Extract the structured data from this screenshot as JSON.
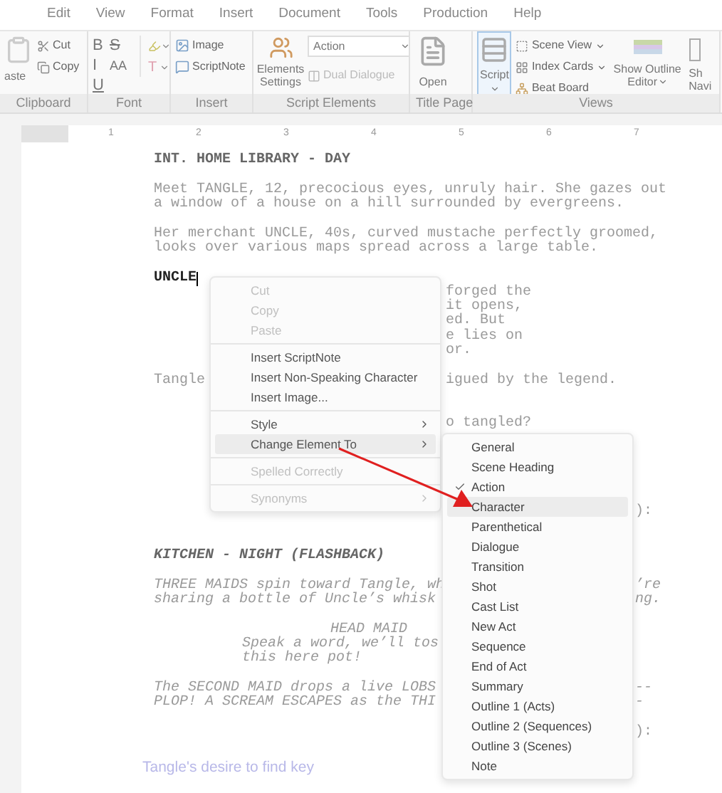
{
  "menu_bar": {
    "tabs": [
      {
        "label": "Edit",
        "selected": false
      },
      {
        "label": "View",
        "selected": false
      },
      {
        "label": "Format",
        "selected": false
      },
      {
        "label": "Insert",
        "selected": false
      },
      {
        "label": "Document",
        "selected": false
      },
      {
        "label": "Tools",
        "selected": false
      },
      {
        "label": "Production",
        "selected": false
      },
      {
        "label": "Help",
        "selected": false
      }
    ]
  },
  "ribbon": {
    "groups": [
      {
        "kind": "clipboard",
        "label": "Clipboard",
        "paste": "aste",
        "cut": "Cut",
        "copy": "Copy"
      },
      {
        "kind": "font",
        "label": "Font",
        "bold": "B",
        "strike": "S",
        "italic": "I",
        "size": "AA",
        "underline": "U",
        "text_color": "T"
      },
      {
        "kind": "insert",
        "label": "Insert",
        "image": "Image",
        "note": "ScriptNote"
      },
      {
        "kind": "elements",
        "label": "Script Elements",
        "settings": "Elements Settings",
        "element": "Action",
        "dual": "Dual Dialogue",
        "dual_disabled": true
      },
      {
        "kind": "title",
        "label": "Title Page",
        "open": "Open"
      },
      {
        "kind": "views",
        "label": "Views",
        "script": "Script",
        "script_selected": true,
        "scene": "Scene View",
        "cards": "Index Cards",
        "beat": "Beat Board",
        "outline": "Show Outline Editor",
        "nav_top": "Sh",
        "nav_bottom": "Navi"
      }
    ]
  },
  "ruler": {
    "labels": [
      "1",
      "2",
      "3",
      "4",
      "5",
      "6",
      "7"
    ]
  },
  "script": {
    "rows": [
      {
        "kind": "heading",
        "text": "INT. HOME LIBRARY - DAY"
      },
      {
        "kind": "blank"
      },
      {
        "kind": "action",
        "text": "Meet TANGLE, 12, precocious eyes, unruly hair. She gazes out"
      },
      {
        "kind": "action",
        "text": "a window of a house on a hill surrounded by evergreens."
      },
      {
        "kind": "blank"
      },
      {
        "kind": "action",
        "text": "Her merchant UNCLE, 40s, curved mustache perfectly groomed,"
      },
      {
        "kind": "action",
        "text": "looks over various maps spread across a large table."
      },
      {
        "kind": "blank"
      },
      {
        "kind": "current",
        "text": "UNCLE"
      },
      {
        "kind": "action",
        "after_menu": "forged the"
      },
      {
        "kind": "action",
        "after_menu": "it opens,"
      },
      {
        "kind": "action",
        "after_menu": "ed. But"
      },
      {
        "kind": "action",
        "after_menu": "e lies on"
      },
      {
        "kind": "action",
        "after_menu": "or."
      },
      {
        "kind": "blank"
      },
      {
        "kind": "action",
        "text": "Tangle",
        "after_menu": "igued by the legend."
      },
      {
        "kind": "blank"
      },
      {
        "kind": "blank"
      },
      {
        "kind": "dialogue",
        "after_menu": "o tangled?"
      },
      {
        "kind": "blank"
      },
      {
        "kind": "blank"
      },
      {
        "kind": "blank"
      },
      {
        "kind": "blank"
      },
      {
        "kind": "blank"
      },
      {
        "kind": "dialogue",
        "after_submenu": "):"
      },
      {
        "kind": "blank"
      },
      {
        "kind": "blank"
      },
      {
        "kind": "heading",
        "italic": true,
        "text": "KITCHEN - NIGHT (FLASHBACK)"
      },
      {
        "kind": "blank"
      },
      {
        "kind": "action",
        "italic": true,
        "text": "THREE MAIDS spin toward Tangle, wh",
        "after_submenu": "’re"
      },
      {
        "kind": "action",
        "italic": true,
        "text": "sharing a bottle of Uncle’s whisk",
        "after_submenu": "ng."
      },
      {
        "kind": "blank"
      },
      {
        "kind": "character",
        "italic": true,
        "text": "HEAD MAID"
      },
      {
        "kind": "dialogue",
        "italic": true,
        "text": "Speak a word, we’ll tos"
      },
      {
        "kind": "dialogue",
        "italic": true,
        "text": "this here pot!"
      },
      {
        "kind": "blank"
      },
      {
        "kind": "action",
        "italic": true,
        "text": "The SECOND MAID drops a live LOBS",
        "after_submenu": "--"
      },
      {
        "kind": "action",
        "italic": true,
        "text": "PLOP! A SCREAM ESCAPES as the THI",
        "after_submenu": "-"
      },
      {
        "kind": "blank"
      },
      {
        "kind": "dialogue",
        "after_submenu": "):"
      }
    ],
    "note": "Tangle's desire to find key"
  },
  "context_menu": {
    "groups": [
      [
        {
          "label": "Cut",
          "disabled": true,
          "submenu": false,
          "selected": false
        },
        {
          "label": "Copy",
          "disabled": true,
          "submenu": false,
          "selected": false
        },
        {
          "label": "Paste",
          "disabled": true,
          "submenu": false,
          "selected": false
        }
      ],
      [
        {
          "label": "Insert ScriptNote",
          "disabled": false,
          "submenu": false,
          "selected": false
        },
        {
          "label": "Insert Non-Speaking Character",
          "disabled": false,
          "submenu": false,
          "selected": false
        },
        {
          "label": "Insert Image...",
          "disabled": false,
          "submenu": false,
          "selected": false
        }
      ],
      [
        {
          "label": "Style",
          "disabled": false,
          "submenu": true,
          "selected": false
        },
        {
          "label": "Change Element To",
          "disabled": false,
          "submenu": true,
          "selected": true
        }
      ],
      [
        {
          "label": "Spelled Correctly",
          "disabled": true,
          "submenu": false,
          "selected": false
        }
      ],
      [
        {
          "label": "Synonyms",
          "disabled": true,
          "submenu": true,
          "selected": false
        }
      ]
    ]
  },
  "submenu": {
    "items": [
      {
        "label": "General",
        "checked": false,
        "selected": false
      },
      {
        "label": "Scene Heading",
        "checked": false,
        "selected": false
      },
      {
        "label": "Action",
        "checked": true,
        "selected": false
      },
      {
        "label": "Character",
        "checked": false,
        "selected": true
      },
      {
        "label": "Parenthetical",
        "checked": false,
        "selected": false
      },
      {
        "label": "Dialogue",
        "checked": false,
        "selected": false
      },
      {
        "label": "Transition",
        "checked": false,
        "selected": false
      },
      {
        "label": "Shot",
        "checked": false,
        "selected": false
      },
      {
        "label": "Cast List",
        "checked": false,
        "selected": false
      },
      {
        "label": "New Act",
        "checked": false,
        "selected": false
      },
      {
        "label": "Sequence",
        "checked": false,
        "selected": false
      },
      {
        "label": "End of Act",
        "checked": false,
        "selected": false
      },
      {
        "label": "Summary",
        "checked": false,
        "selected": false
      },
      {
        "label": "Outline 1 (Acts)",
        "checked": false,
        "selected": false
      },
      {
        "label": "Outline 2 (Sequences)",
        "checked": false,
        "selected": false
      },
      {
        "label": "Outline 3 (Scenes)",
        "checked": false,
        "selected": false
      },
      {
        "label": "Note",
        "checked": false,
        "selected": false
      }
    ]
  }
}
